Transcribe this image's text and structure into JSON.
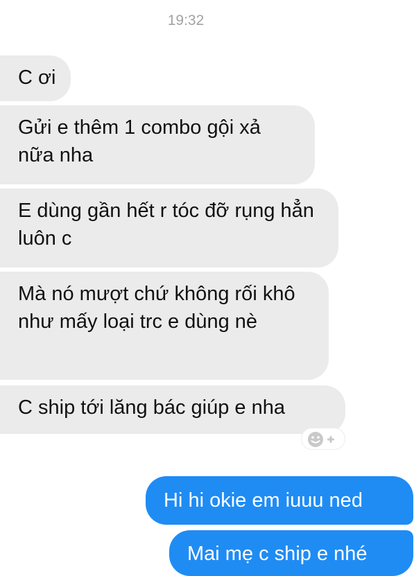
{
  "chat": {
    "timestamp": "19:32",
    "incoming": [
      "C ơi",
      "Gửi e thêm 1 combo gội xả nữa nha",
      "E dùng gần hết r tóc đỡ rụng hẳn luôn c",
      "Mà nó mượt chứ không rối khô như mấy loại trc e dùng nè",
      "C ship tới lăng bác giúp e nha"
    ],
    "outgoing": [
      "Hi hi okie em iuuu ned",
      "Mai mẹ c ship e nhé"
    ]
  },
  "icons": {
    "reaction": "add-reaction-icon"
  },
  "colors": {
    "incoming_bubble": "#ebebeb",
    "outgoing_bubble": "#1f8cf4",
    "timestamp": "#a3a3a3"
  }
}
